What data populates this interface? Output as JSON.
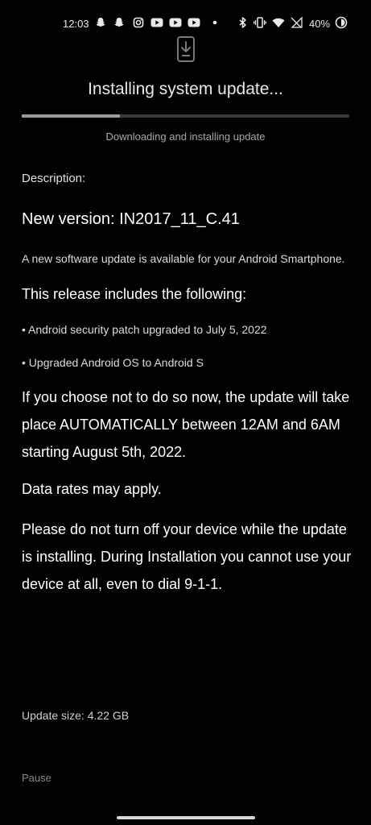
{
  "status_bar": {
    "time": "12:03",
    "battery_percent": "40%",
    "icons": [
      "snapchat-icon",
      "snapchat-icon",
      "instagram-icon",
      "youtube-icon",
      "youtube-icon",
      "youtube-icon",
      "dot-icon",
      "bluetooth-icon",
      "vibrate-icon",
      "wifi-icon",
      "no-signal-icon",
      "battery-icon"
    ]
  },
  "header": {
    "icon": "system-update-icon",
    "title": "Installing system update...",
    "progress": 0.3,
    "progress_label": "Downloading and installing update"
  },
  "content": {
    "description_label": "Description:",
    "version": "New version: IN2017_11_C.41",
    "intro": "A new software update is available for your Android Smartphone.",
    "includes_heading": "This release includes the following:",
    "bullets": [
      "• Android security patch upgraded to July 5, 2022",
      "• Upgraded Android OS to Android S"
    ],
    "auto_notice": "If you choose not to do so now, the update will take place AUTOMATICALLY between 12AM and 6AM starting August 5th, 2022.",
    "data_rates": "Data rates may apply.",
    "warning": "Please do not turn off your device while the update is installing. During Installation you cannot use your device at all, even to dial 9-1-1."
  },
  "footer": {
    "update_size": "Update size: 4.22 GB",
    "pause_label": "Pause"
  },
  "colors": {
    "background": "#000000",
    "progress_fill": "#9a9a9a",
    "progress_track": "#3a3a3a"
  }
}
